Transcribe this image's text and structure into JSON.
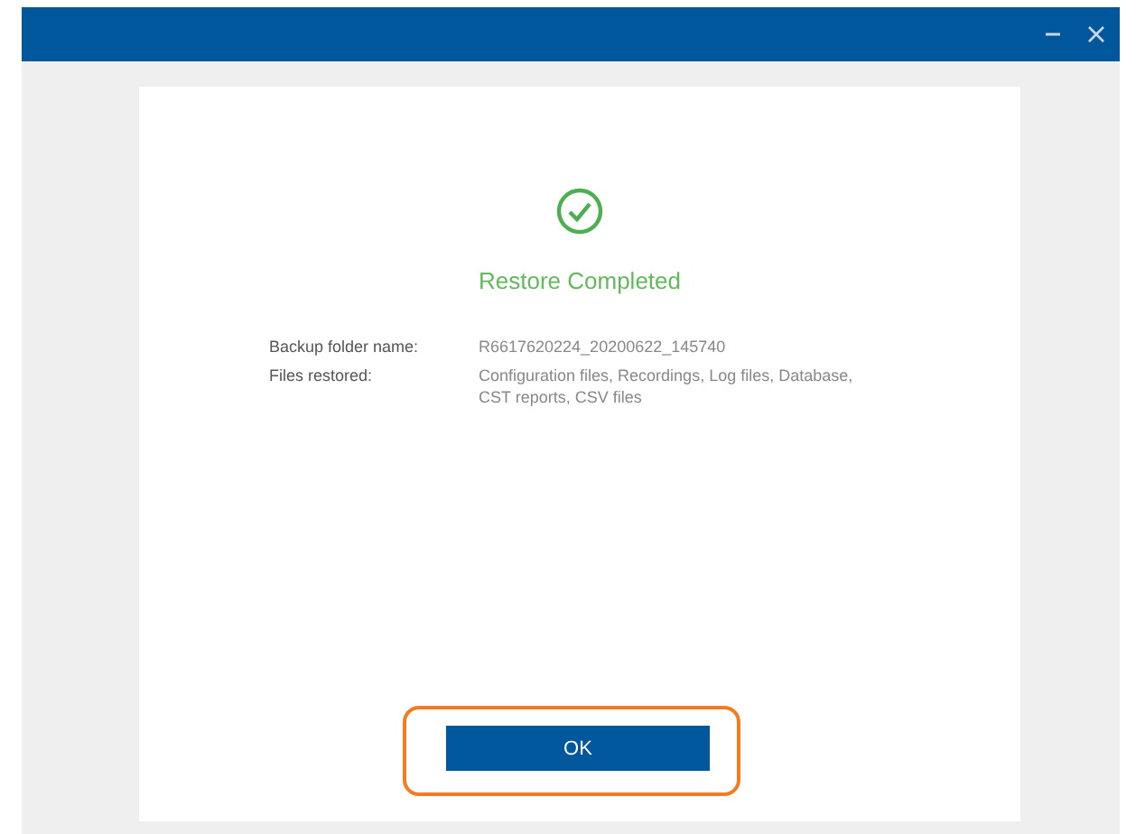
{
  "window": {
    "title_bar": {
      "controls": [
        {
          "kind": "minimize"
        },
        {
          "kind": "close"
        }
      ]
    }
  },
  "dialog": {
    "icon": {
      "kind": "success"
    },
    "title": "Restore Completed",
    "details": [
      {
        "label": "Backup folder name:",
        "value": "R6617620224_20200622_145740"
      },
      {
        "label": "Files restored:",
        "value": "Configuration files, Recordings, Log files, Database, CST reports, CSV files"
      }
    ],
    "button": {
      "label": "OK",
      "highlighted": true
    }
  }
}
